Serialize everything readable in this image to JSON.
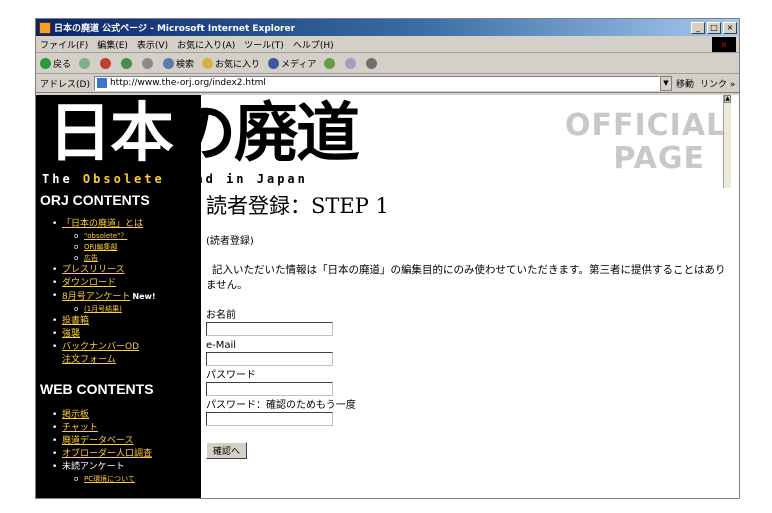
{
  "window": {
    "title": "日本の廃道 公式ページ - Microsoft Internet Explorer",
    "controls": [
      "_",
      "□",
      "×"
    ]
  },
  "menubar": {
    "items": [
      "ファイル(F)",
      "編集(E)",
      "表示(V)",
      "お気に入り(A)",
      "ツール(T)",
      "ヘルプ(H)"
    ]
  },
  "toolbar": {
    "back": "戻る",
    "search": "検索",
    "favorites": "お気に入り",
    "media": "メディア"
  },
  "addressbar": {
    "label": "アドレス(D)",
    "url": "http://www.the-orj.org/index2.html",
    "go": "移動",
    "links": "リンク »"
  },
  "banner": {
    "logo_main_white": "日本",
    "logo_main_dark": "の廃道",
    "logo_sub_the": "The",
    "logo_sub_obsolete": "Obsolete",
    "logo_sub_rest": "Road in Japan",
    "official_line1": "OFFICIAL",
    "official_line2": "PAGE"
  },
  "sidebar": {
    "orj_heading": "ORJ CONTENTS",
    "orj_items": [
      {
        "label": "「日本の廃道」とは",
        "link": true
      },
      {
        "label": "\"obsolete\"？",
        "link": true,
        "sub": true
      },
      {
        "label": "ORJ編集部",
        "link": true,
        "sub": true
      },
      {
        "label": "広告",
        "link": true,
        "sub": true
      },
      {
        "label": "プレスリリース",
        "link": true
      },
      {
        "label": "ダウンロード",
        "link": true
      },
      {
        "label": "8月号アンケート",
        "link": true,
        "badge": "New!"
      },
      {
        "label": "(1月号結果)",
        "link": true,
        "sub": true
      },
      {
        "label": "投書箱",
        "link": true
      },
      {
        "label": "強襲",
        "link": true
      },
      {
        "label": "バックナンバーOD",
        "link": true
      },
      {
        "label": "注文フォーム",
        "link": true,
        "cont": true
      }
    ],
    "web_heading": "WEB CONTENTS",
    "web_items": [
      {
        "label": "掲示板",
        "link": true
      },
      {
        "label": "チャット",
        "link": true
      },
      {
        "label": "廃道データベース",
        "link": true
      },
      {
        "label": "オブローダー人口調査",
        "link": true
      },
      {
        "label": "未読アンケート",
        "link": false
      },
      {
        "label": "PC環境について",
        "link": true,
        "sub": true
      }
    ]
  },
  "main": {
    "heading": "読者登録：STEP 1",
    "reg_label": "(読者登録)",
    "intro": "記入いただいた情報は「日本の廃道」の編集目的にのみ使わせていただきます。第三者に提供することはありません。",
    "fields": [
      {
        "label": "お名前",
        "value": ""
      },
      {
        "label": "e-Mail",
        "value": ""
      },
      {
        "label": "パスワード",
        "value": ""
      },
      {
        "label": "パスワード：確認のためもう一度",
        "value": ""
      }
    ],
    "submit": "確認へ"
  }
}
